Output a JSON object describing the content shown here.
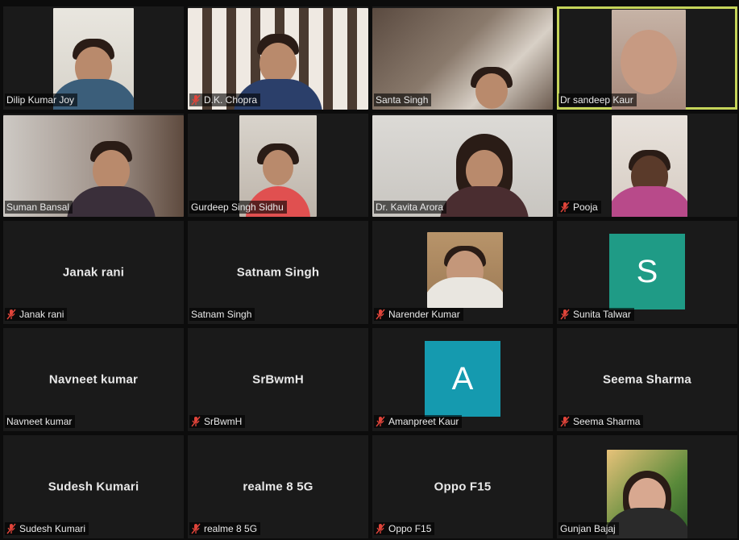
{
  "colors": {
    "active_speaker_border": "#c5d45a",
    "tile_background": "#1a1a1a",
    "muted_icon": "#e0443a",
    "avatar_s": "#1f9b86",
    "avatar_a": "#159aaf"
  },
  "tiles": [
    {
      "label": "Dilip Kumar Joy",
      "muted": false,
      "kind": "video",
      "active": false
    },
    {
      "label": "D.K. Chopra",
      "muted": true,
      "kind": "video",
      "active": false
    },
    {
      "label": "Santa Singh",
      "muted": false,
      "kind": "video",
      "active": false
    },
    {
      "label": "Dr sandeep Kaur",
      "muted": false,
      "kind": "video",
      "active": true
    },
    {
      "label": "Suman Bansal",
      "muted": false,
      "kind": "video",
      "active": false
    },
    {
      "label": "Gurdeep Singh Sidhu",
      "muted": false,
      "kind": "video",
      "active": false
    },
    {
      "label": "Dr. Kavita Arora",
      "muted": false,
      "kind": "video",
      "active": false
    },
    {
      "label": "Pooja",
      "muted": true,
      "kind": "video",
      "active": false
    },
    {
      "label": "Janak rani",
      "display_name": "Janak rani",
      "muted": true,
      "kind": "name",
      "active": false
    },
    {
      "label": "Satnam Singh",
      "display_name": "Satnam Singh",
      "muted": false,
      "kind": "name",
      "active": false
    },
    {
      "label": "Narender Kumar",
      "muted": true,
      "kind": "video",
      "active": false
    },
    {
      "label": "Sunita Talwar",
      "avatar_letter": "S",
      "muted": true,
      "kind": "avatar",
      "active": false
    },
    {
      "label": "Navneet kumar",
      "display_name": "Navneet kumar",
      "muted": false,
      "kind": "name",
      "active": false
    },
    {
      "label": "SrBwmH",
      "display_name": "SrBwmH",
      "muted": true,
      "kind": "name",
      "active": false
    },
    {
      "label": "Amanpreet Kaur",
      "avatar_letter": "A",
      "muted": true,
      "kind": "avatar",
      "active": false
    },
    {
      "label": "Seema Sharma",
      "display_name": "Seema Sharma",
      "muted": true,
      "kind": "name",
      "active": false
    },
    {
      "label": "Sudesh Kumari",
      "display_name": "Sudesh Kumari",
      "muted": true,
      "kind": "name",
      "active": false
    },
    {
      "label": "realme 8 5G",
      "display_name": "realme 8 5G",
      "muted": true,
      "kind": "name",
      "active": false
    },
    {
      "label": "Oppo F15",
      "display_name": "Oppo F15",
      "muted": true,
      "kind": "name",
      "active": false
    },
    {
      "label": "Gunjan Bajaj",
      "muted": false,
      "kind": "video",
      "active": false
    }
  ]
}
